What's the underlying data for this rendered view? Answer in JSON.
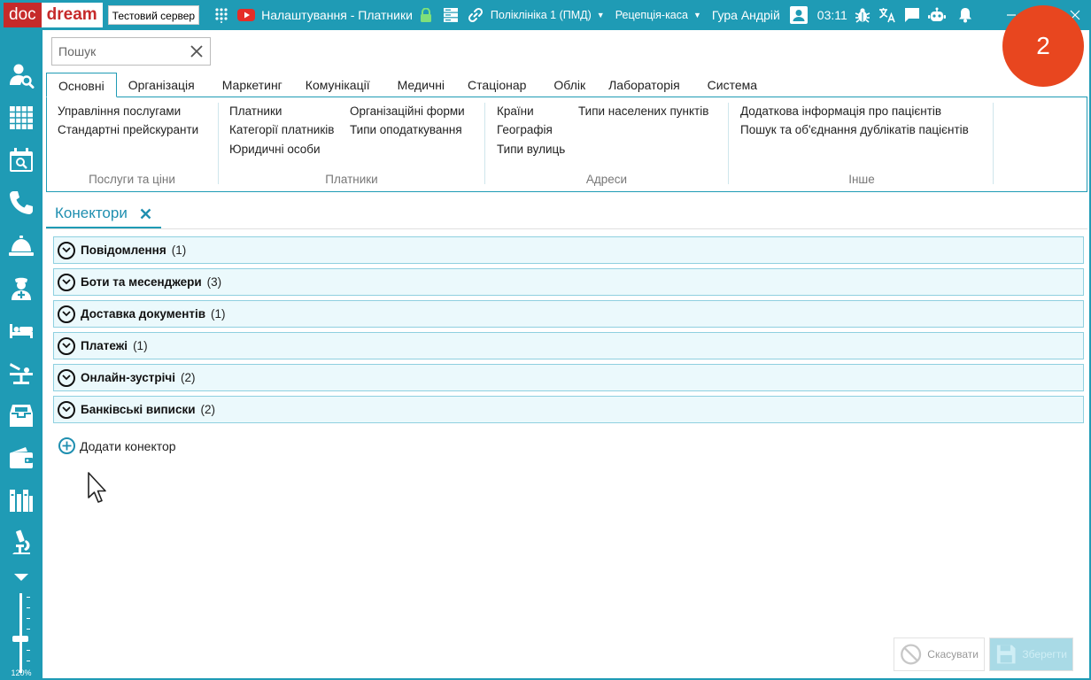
{
  "titlebar": {
    "logo_doc": "doc",
    "logo_dream": "dream",
    "server_badge": "Тестовий сервер",
    "title": "Налаштування - Платники",
    "clinic": "Поліклініка 1 (ПМД)",
    "workplace": "Рецепція-каса",
    "user": "Гура Андрій",
    "time": "03:11",
    "colors": {
      "bar": "#1f9bb5",
      "logo_red": "#c62a2a"
    }
  },
  "sidebar": {
    "icons": [
      "patient-search-icon",
      "schedule-grid-icon",
      "calendar-search-icon",
      "phone-icon",
      "reception-bell-icon",
      "doctor-icon",
      "bed-icon",
      "operating-table-icon",
      "archive-box-icon",
      "wallet-icon",
      "library-icon",
      "microscope-icon"
    ],
    "zoom_label": "120%"
  },
  "search": {
    "placeholder": "Пошук",
    "value": ""
  },
  "badge": {
    "value": "2",
    "color": "#e8461f"
  },
  "menu_tabs": [
    "Основні",
    "Організація",
    "Маркетинг",
    "Комунікації",
    "Медичні",
    "Стаціонар",
    "Облік",
    "Лабораторія",
    "Система"
  ],
  "ribbon": {
    "services": {
      "items": [
        "Управління послугами",
        "Стандартні прейскуранти"
      ],
      "label": "Послуги та ціни"
    },
    "payers": {
      "col1": [
        "Платники",
        "Категорії платників",
        "Юридичні особи"
      ],
      "col2": [
        "Організаційні форми",
        "Типи оподаткування"
      ],
      "label": "Платники"
    },
    "addresses": {
      "col1": [
        "Країни",
        "Географія",
        "Типи вулиць"
      ],
      "col2": [
        "Типи населених пунктів"
      ],
      "label": "Адреси"
    },
    "other": {
      "items": [
        "Додаткова інформація про пацієнтів",
        "Пошук та об'єднання дублікатів пацієнтів"
      ],
      "label": "Інше"
    }
  },
  "content_tab": {
    "label": "Конектори"
  },
  "sections": [
    {
      "name": "Повідомлення",
      "count": "(1)"
    },
    {
      "name": "Боти та месенджери",
      "count": "(3)"
    },
    {
      "name": "Доставка документів",
      "count": "(1)"
    },
    {
      "name": "Платежі",
      "count": "(1)"
    },
    {
      "name": "Онлайн-зустрічі",
      "count": "(2)"
    },
    {
      "name": "Банківські виписки",
      "count": "(2)"
    }
  ],
  "add_connector": {
    "label": "Додати конектор"
  },
  "footer": {
    "cancel_label": "Скасувати",
    "save_label": "Зберегти"
  }
}
